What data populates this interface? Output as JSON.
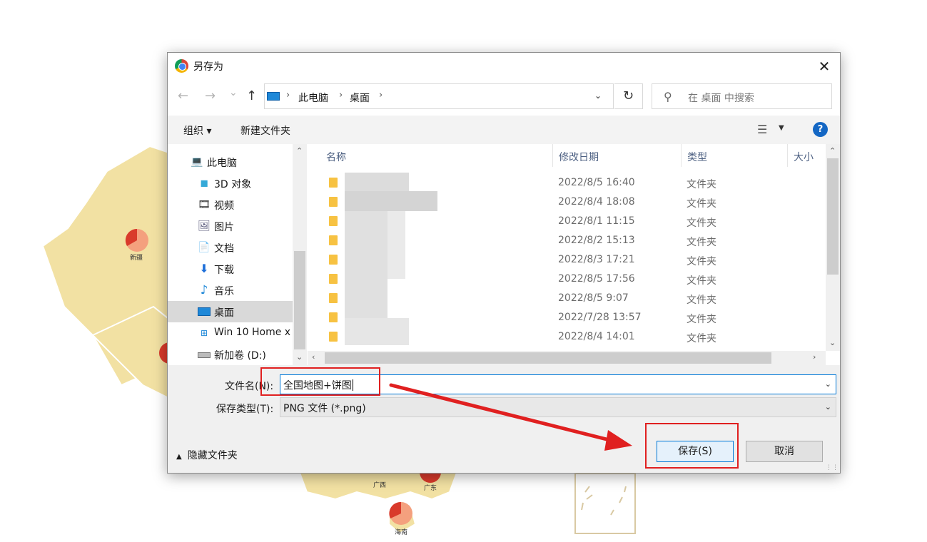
{
  "dialog": {
    "title": "另存为",
    "close_symbol": "✕"
  },
  "nav": {
    "back_symbol": "←",
    "forward_symbol": "→",
    "recent_symbol": "⌄",
    "up_symbol": "↑",
    "breadcrumb": [
      "此电脑",
      "桌面"
    ],
    "crumb_separator": "›",
    "refresh_symbol": "↻",
    "search_placeholder": "在 桌面 中搜索"
  },
  "toolbar": {
    "organize_label": "组织 ▾",
    "new_folder_label": "新建文件夹",
    "help_symbol": "?"
  },
  "navpane": {
    "items": [
      {
        "label": "此电脑",
        "icon": "computer-icon"
      },
      {
        "label": "3D 对象",
        "icon": "cube-icon"
      },
      {
        "label": "视频",
        "icon": "video-icon"
      },
      {
        "label": "图片",
        "icon": "picture-icon"
      },
      {
        "label": "文档",
        "icon": "document-icon"
      },
      {
        "label": "下载",
        "icon": "download-icon"
      },
      {
        "label": "音乐",
        "icon": "music-icon"
      },
      {
        "label": "桌面",
        "icon": "desktop-icon",
        "selected": true
      },
      {
        "label": "Win 10 Home x",
        "icon": "windows-drive-icon"
      },
      {
        "label": "新加卷 (D:)",
        "icon": "drive-icon"
      }
    ]
  },
  "files": {
    "columns": [
      "名称",
      "修改日期",
      "类型",
      "大小"
    ],
    "rows": [
      {
        "date": "2022/8/5 16:40",
        "type": "文件夹"
      },
      {
        "date": "2022/8/4 18:08",
        "type": "文件夹"
      },
      {
        "date": "2022/8/1 11:15",
        "type": "文件夹"
      },
      {
        "date": "2022/8/2 15:13",
        "type": "文件夹"
      },
      {
        "date": "2022/8/3 17:21",
        "type": "文件夹"
      },
      {
        "date": "2022/8/5 17:56",
        "type": "文件夹"
      },
      {
        "date": "2022/8/5 9:07",
        "type": "文件夹"
      },
      {
        "date": "2022/7/28 13:57",
        "type": "文件夹"
      },
      {
        "date": "2022/8/4 14:01",
        "type": "文件夹"
      }
    ]
  },
  "form": {
    "filename_label": "文件名(N):",
    "filename_value": "全国地图+饼图",
    "filetype_label": "保存类型(T):",
    "filetype_value": "PNG 文件 (*.png)"
  },
  "footer": {
    "hide_folders_label": "隐藏文件夹",
    "save_label": "保存(S)",
    "cancel_label": "取消"
  },
  "map_labels": {
    "xinjiang": "新疆",
    "guangxi": "广西",
    "guangdong": "广东",
    "hainan": "海南"
  },
  "colors": {
    "map_fill": "#f2e1a3",
    "map_border": "#ffffff",
    "pie_primary": "#d93a2b",
    "pie_secondary": "#f4a07e",
    "annotation": "#e02020",
    "accent": "#0078d7"
  }
}
